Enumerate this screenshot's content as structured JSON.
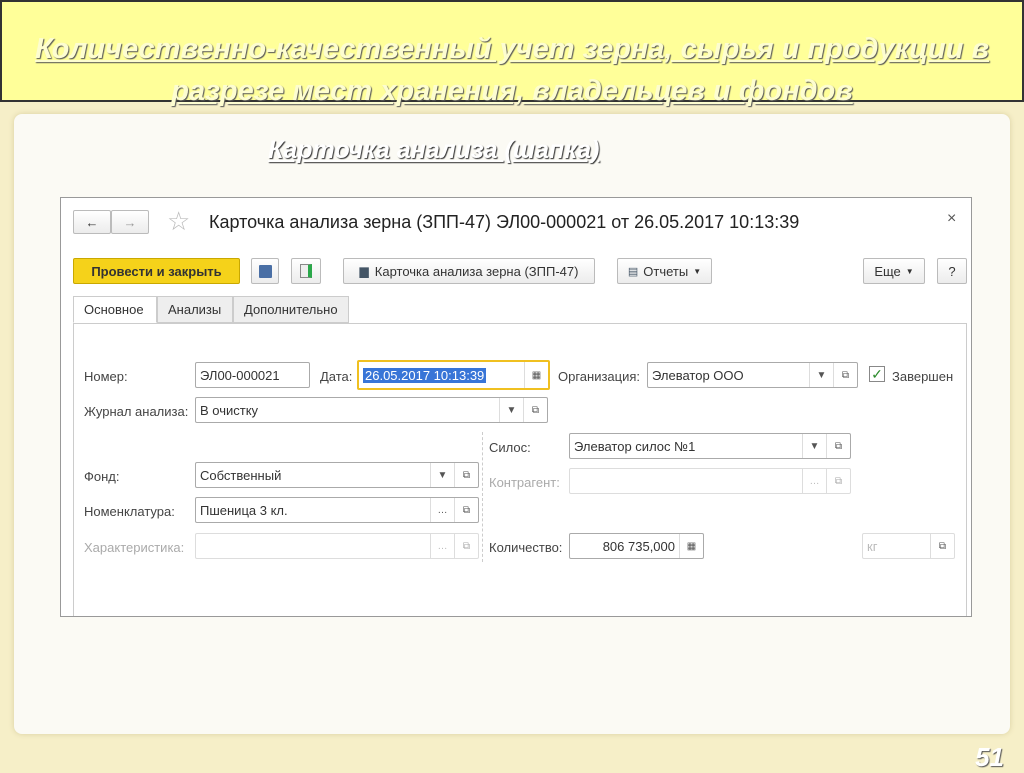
{
  "slide": {
    "title_line1": "Количественно-качественный учет зерна, сырья и продукции в",
    "title_line2": "разрезе мест хранения, владельцев и фондов",
    "subtitle": "Карточка анализа (шапка)",
    "page_number": "51"
  },
  "window": {
    "title": "Карточка анализа зерна (ЗПП-47) ЭЛ00-000021 от 26.05.2017 10:13:39",
    "close": "×",
    "back": "←",
    "forward": "→",
    "star": "☆"
  },
  "toolbar": {
    "post_close": "Провести и закрыть",
    "print_label": "Карточка анализа зерна (ЗПП-47)",
    "reports": "Отчеты",
    "more": "Еще",
    "help": "?"
  },
  "tabs": [
    "Основное",
    "Анализы",
    "Дополнительно"
  ],
  "form": {
    "number_label": "Номер:",
    "number": "ЭЛ00-000021",
    "date_label": "Дата:",
    "date": "26.05.2017 10:13:39",
    "org_label": "Организация:",
    "org": "Элеватор ООО",
    "completed_label": "Завершен",
    "journal_label": "Журнал анализа:",
    "journal": "В очистку",
    "silo_label": "Силос:",
    "silo": "Элеватор силос №1",
    "fund_label": "Фонд:",
    "fund": "Собственный",
    "counterparty_label": "Контрагент:",
    "counterparty": "",
    "nomenclature_label": "Номенклатура:",
    "nomenclature": "Пшеница 3 кл.",
    "characteristic_label": "Характеристика:",
    "characteristic": "",
    "quantity_label": "Количество:",
    "quantity": "806 735,000",
    "unit_placeholder": "кг"
  },
  "colors": {
    "accent": "#f5d21a",
    "banner": "#ffff99"
  }
}
